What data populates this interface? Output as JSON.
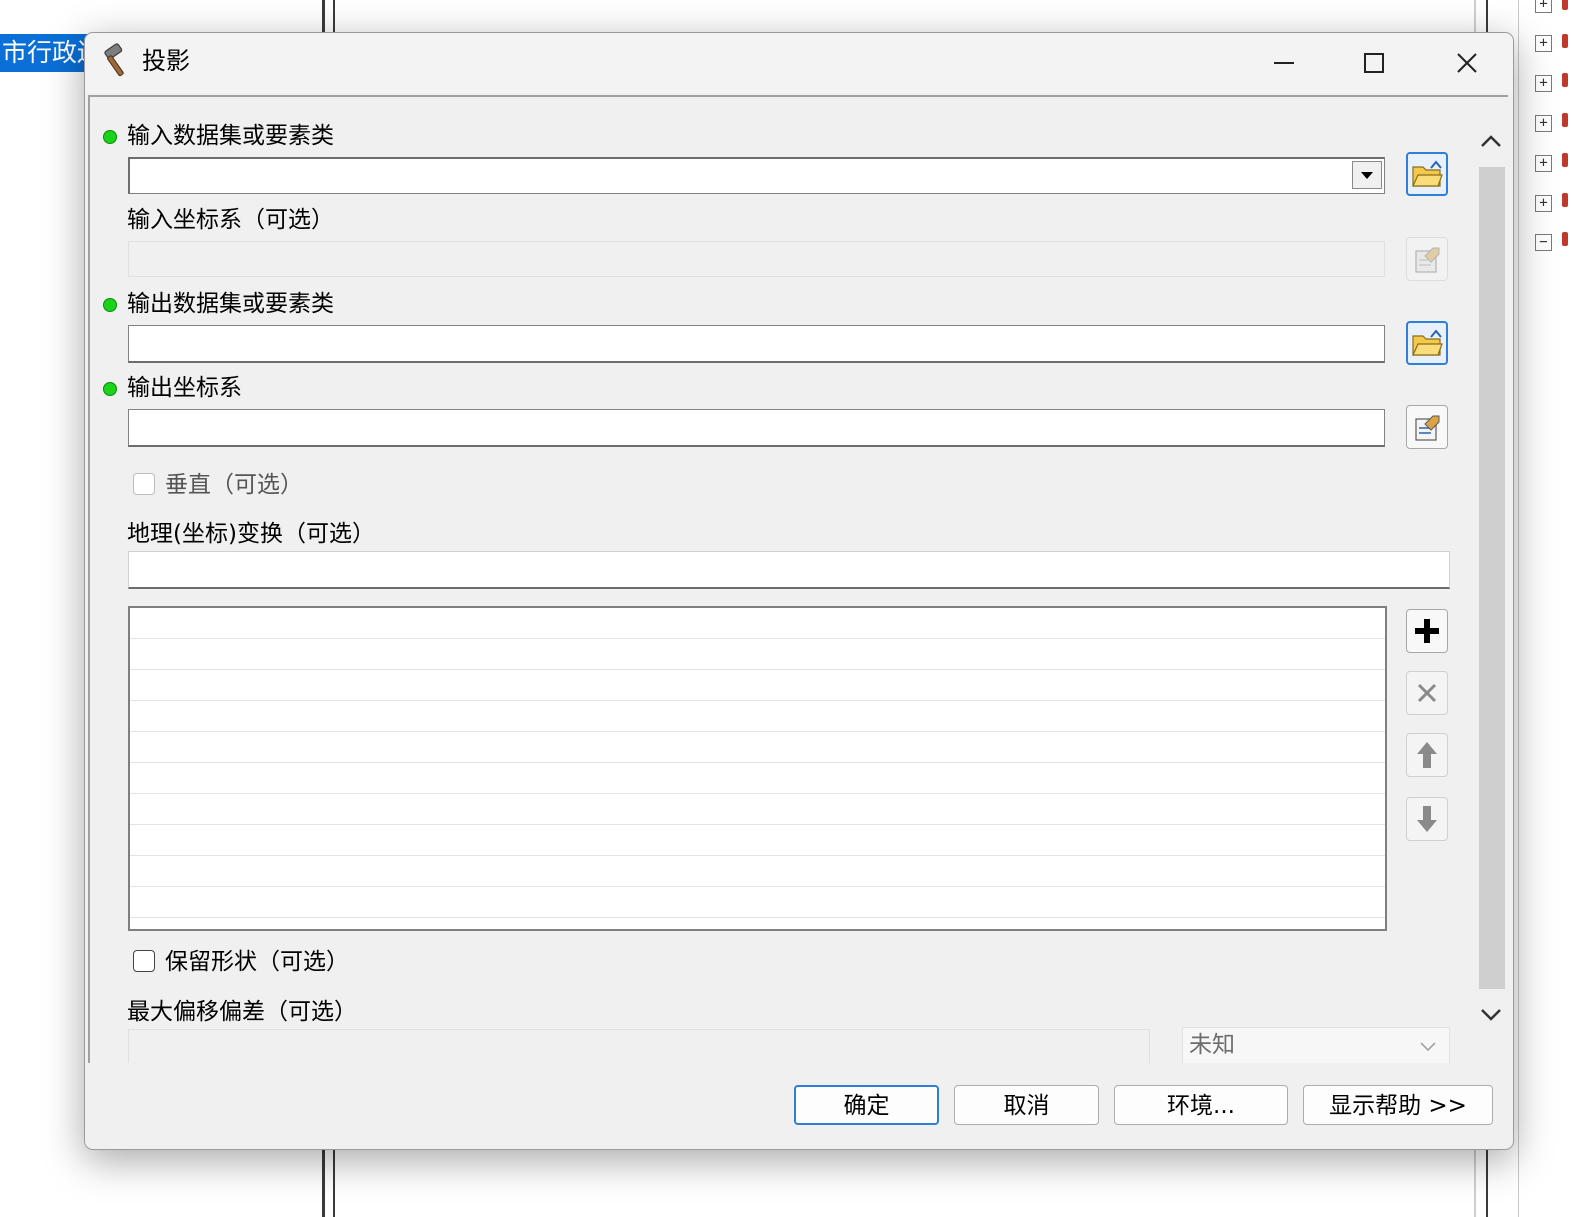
{
  "background": {
    "left_selected_text": "市行政边"
  },
  "dialog": {
    "title": "投影",
    "title_icon": "hammer-icon",
    "window_buttons": [
      "minimize-icon",
      "maximize-icon",
      "close-icon"
    ]
  },
  "form": {
    "input_dataset_label": "输入数据集或要素类",
    "input_dataset_value": "",
    "input_crs_label": "输入坐标系（可选）",
    "input_crs_value": "",
    "output_dataset_label": "输出数据集或要素类",
    "output_dataset_value": "",
    "output_crs_label": "输出坐标系",
    "output_crs_value": "",
    "vertical_label": "垂直（可选）",
    "vertical_checked": false,
    "geo_transform_label": "地理(坐标)变换（可选）",
    "geo_transform_value": "",
    "transform_list_rows": 10,
    "preserve_shape_label": "保留形状（可选）",
    "preserve_shape_checked": false,
    "max_deviation_label": "最大偏移偏差（可选）",
    "max_deviation_value": "",
    "max_deviation_unit": "未知"
  },
  "list_tools": [
    "add-icon",
    "remove-icon",
    "move-up-icon",
    "move-down-icon"
  ],
  "footer": {
    "ok": "确定",
    "cancel": "取消",
    "environments": "环境...",
    "show_help": "显示帮助 >>"
  },
  "colors": {
    "required_dot": "#19d419",
    "selection_blue": "#0a6fd6",
    "default_button_border": "#2e7fd6"
  }
}
